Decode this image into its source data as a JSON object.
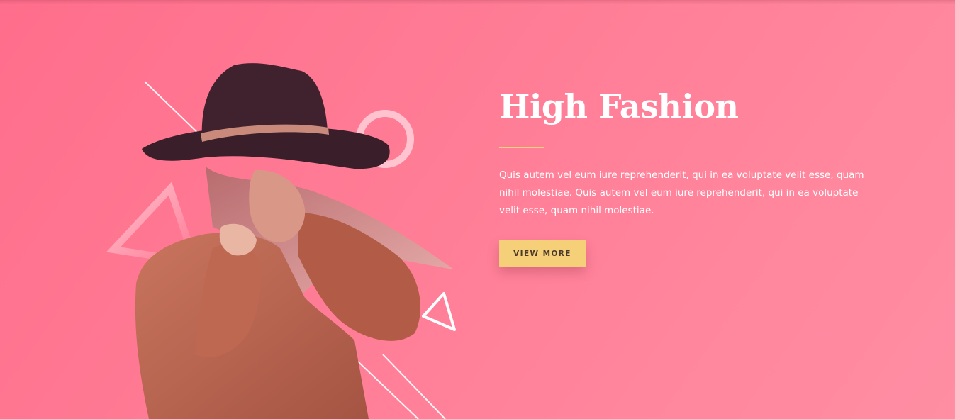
{
  "hero": {
    "title": "High Fashion",
    "body": "Quis autem vel eum iure reprehenderit, qui in ea voluptate velit esse, quam nihil molestiae. Quis autem vel eum iure reprehenderit, qui in ea voluptate velit esse, quam nihil molestiae.",
    "button_label": "VIEW MORE"
  },
  "colors": {
    "background_start": "#ff6e8c",
    "background_end": "#ff8ea3",
    "accent_yellow": "#f6d079",
    "text": "#ffffff",
    "button_text": "#4a3a2c"
  },
  "icons": [
    "ring-decoration-icon",
    "triangle-decoration-icon",
    "line-decoration-icon"
  ]
}
